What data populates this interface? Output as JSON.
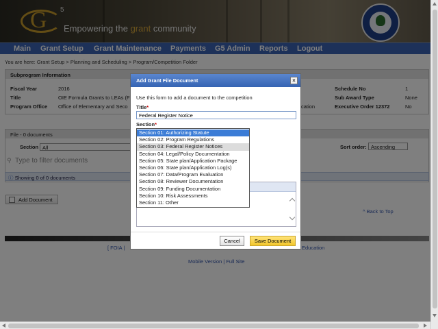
{
  "header": {
    "logo_g": "G",
    "logo_5": "5",
    "tagline_before": "Empowering the ",
    "tagline_accent": "grant",
    "tagline_after": " community"
  },
  "nav": {
    "items": [
      "Main",
      "Grant Setup",
      "Grant Maintenance",
      "Payments",
      "G5 Admin",
      "Reports",
      "Logout"
    ]
  },
  "breadcrumb": "You are here: Grant Setup > Planning and Scheduling > Program/Competition Folder",
  "subprogram": {
    "heading": "Subprogram Information",
    "fiscal_year_label": "Fiscal Year",
    "fiscal_year_value": "2016",
    "title_label": "Title",
    "title_value": "OIE Formula Grants to LEAs (F",
    "program_office_label": "Program Office",
    "program_office_value": "Office of Elementary and Seco",
    "partial_text": "cation",
    "schedule_no_label": "Schedule No",
    "schedule_no_value": "1",
    "sub_award_label": "Sub Award Type",
    "sub_award_value": "None",
    "exec_order_label": "Executive Order 12372",
    "exec_order_value": "No"
  },
  "files": {
    "heading": "File - 0 documents",
    "section_label": "Section",
    "section_value": "All",
    "sort_label": "Sort order:",
    "sort_value": "Ascending",
    "filter_placeholder": "Type to filter documents",
    "showing": "Showing 0 of 0 documents",
    "add_document": "Add Document",
    "back_to_top": "^ Back to Top"
  },
  "footer": {
    "foia": "[ FOIA | ",
    "partial_text": "Education",
    "mobile": "Mobile Version",
    "separator": " | ",
    "full": "Full Site"
  },
  "dialog": {
    "title": "Add Grant File Document",
    "close": "×",
    "intro": "Use this form to add a document to the competition",
    "title_label": "Title",
    "title_value": "Federal Register Notice",
    "section_label": "Section",
    "required_mark": "*",
    "section_options": [
      "Section 01: Authorizing Statute",
      "Section 02: Program Regulations",
      "Section 03: Federal Register Notices",
      "Section 04: Legal/Policy Documentation",
      "Section 05: State plan/Application Package",
      "Section 06: State plan/Application Log(s)",
      "Section 07: Data/Program Evaluation",
      "Section 08: Reviewer Documentation",
      "Section 09: Funding Documentation",
      "Section 10: Risk Assessments",
      "Section 11: Other"
    ],
    "selected_index": 0,
    "hover_index": 2,
    "cancel": "Cancel",
    "save": "Save Document"
  }
}
